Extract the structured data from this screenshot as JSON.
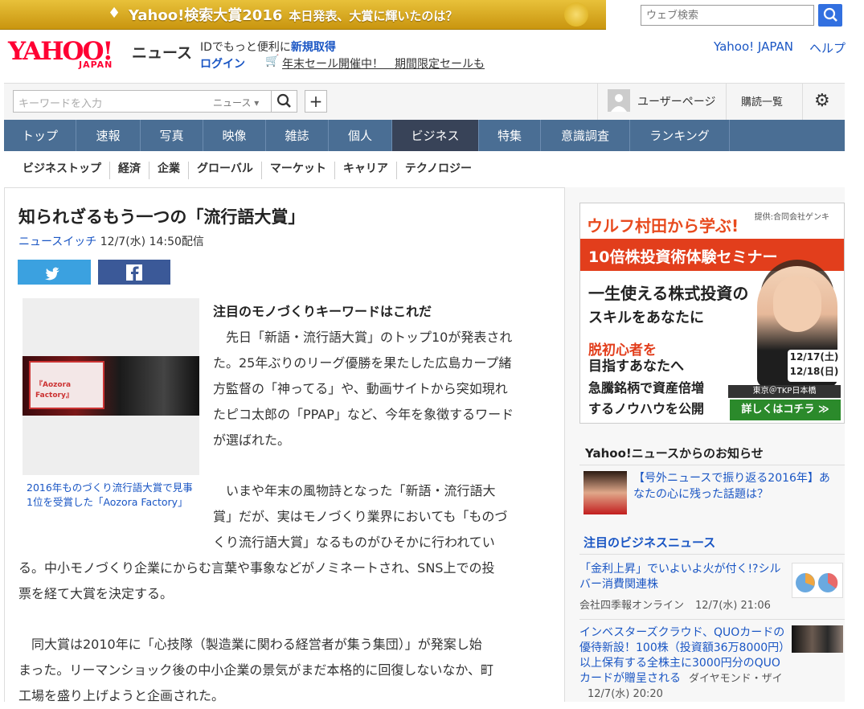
{
  "banner": {
    "title": "Yahoo!検索大賞2016",
    "subtitle": "本日発表、大賞に輝いたのは？"
  },
  "search": {
    "placeholder": "ウェブ検索"
  },
  "header": {
    "logo_text": "YAHOO!",
    "logo_sub": "JAPAN",
    "service": "ニュース",
    "promo_text": "IDでもっと便利に",
    "promo_link": "新規取得",
    "login": "ログイン",
    "sale": "年末セール開催中！　期間限定セールも",
    "yahoo_japan": "Yahoo! JAPAN",
    "help": "ヘルプ"
  },
  "toolbar": {
    "keyword_placeholder": "キーワードを入力",
    "category": "ニュース ▾",
    "plus": "+",
    "user_page": "ユーザーページ",
    "subscriptions": "購読一覧"
  },
  "nav": [
    {
      "label": "トップ",
      "active": false
    },
    {
      "label": "速報",
      "active": false
    },
    {
      "label": "写真",
      "active": false
    },
    {
      "label": "映像",
      "active": false
    },
    {
      "label": "雑誌",
      "active": false
    },
    {
      "label": "個人",
      "active": false
    },
    {
      "label": "ビジネス",
      "active": true
    },
    {
      "label": "特集",
      "active": false
    },
    {
      "label": "意識調査",
      "active": false
    },
    {
      "label": "ランキング",
      "active": false
    }
  ],
  "subnav": [
    "ビジネストップ",
    "経済",
    "企業",
    "グローバル",
    "マーケット",
    "キャリア",
    "テクノロジー"
  ],
  "article": {
    "title": "知られざるもう一つの「流行語大賞」",
    "source": "ニュースイッチ",
    "date": "12/7(水) 14:50配信",
    "photo_screen_text": "『Aozora Factory』",
    "caption": "2016年ものづくり流行語大賞で見事1位を受賞した「Aozora Factory」",
    "subhead": "注目のモノづくりキーワードはこれだ",
    "p1": [
      "先日「新語・流行語大賞」のトップ10が発表され",
      "た。25年ぶりのリーグ優勝を果たした広島カープ緒",
      "方監督の「神ってる」や、動画サイトから突如現れ",
      "たピコ太郎の「PPAP」など、今年を象徴するワード",
      "が選ばれた。"
    ],
    "p2": [
      "いまや年末の風物詩となった「新語・流行語大",
      "賞」だが、実はモノづくり業界においても「ものづ",
      "くり流行語大賞」なるものがひそかに行われてい"
    ],
    "p2b": [
      "る。中小モノづくり企業にからむ言葉や事象などがノミネートされ、SNS上での投",
      "票を経て大賞を決定する。"
    ],
    "p3": [
      "同大賞は2010年に「心技隊（製造業に関わる経営者が集う集団）」が発案し始",
      "まった。リーマンショック後の中小企業の景気がまだ本格的に回復しないなか、町",
      "工場を盛り上げようと企画された。"
    ]
  },
  "ad": {
    "provider": "提供:合同会社ゲンキ",
    "brand": "ウルフ村田から学ぶ!",
    "headline": "10倍株投資術体験セミナー",
    "line2": "一生使える株式投資の",
    "line3": "スキルをあなたに",
    "line4": "脱初心者を",
    "line5": "目指すあなたへ",
    "line6": "急騰銘柄で資産倍増",
    "line7": "するノウハウを公開",
    "date1": "12/17(土)",
    "date2": "12/18(日)",
    "place": "東京＠TKP日本橋",
    "cta": "詳しくはコチラ ≫"
  },
  "notice": {
    "title": "Yahoo!ニュースからのお知らせ",
    "link": "【号外ニュースで振り返る2016年】あなたの心に残った話題は？"
  },
  "biz": {
    "title": "注目のビジネスニュース",
    "items": [
      {
        "headline": "「金利上昇」でいよいよ火が付く!?シルバー消費関連株",
        "source": "会社四季報オンライン",
        "date": "12/7(水) 21:06"
      },
      {
        "headline": "インベスターズクラウド、QUOカードの優待新設！100株（投資額36万8000円）以上保有する全株主に3000円分のQUOカードが贈呈される",
        "source": "ダイヤモンド・ザイ",
        "date": "12/7(水) 20:20"
      }
    ]
  }
}
